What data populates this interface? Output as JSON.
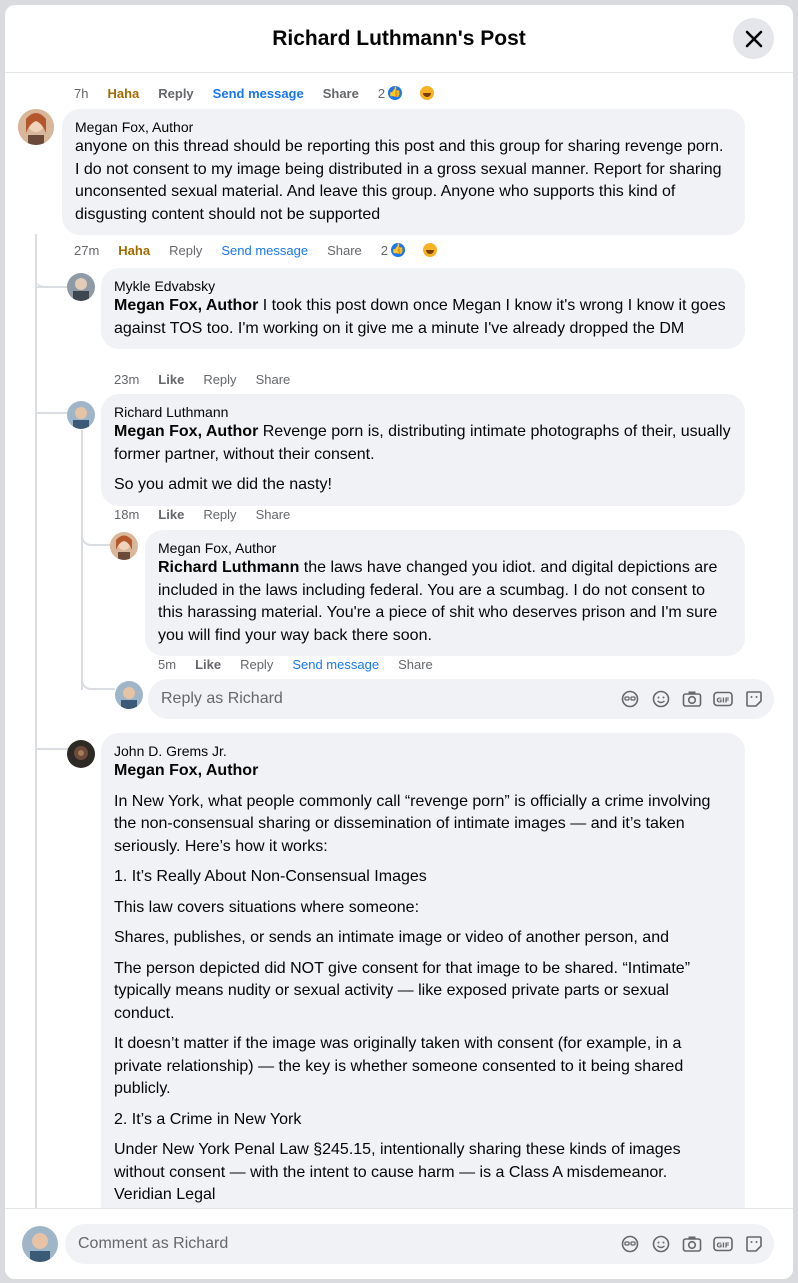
{
  "header": {
    "title": "Richard Luthmann's Post"
  },
  "top_actions": {
    "time": "7h",
    "reaction": "Haha",
    "reply": "Reply",
    "send": "Send message",
    "share": "Share",
    "count": "2"
  },
  "c1": {
    "name": "Megan Fox, Author",
    "text": "anyone on this thread should be reporting this post and this group for sharing revenge porn. I do not consent to my image being distributed in a gross sexual manner. Report for sharing unconsented sexual material. And leave this group. Anyone who supports this kind of disgusting content should not be supported",
    "time": "27m",
    "reaction": "Haha",
    "reply": "Reply",
    "send": "Send message",
    "share": "Share",
    "count": "2"
  },
  "c2": {
    "name": "Mykle Edvabsky",
    "tag": "Megan Fox, Author",
    "text": " I took this post down once Megan I know it's wrong I know it goes against TOS too. I'm working on it give me a minute I've already dropped the DM",
    "time": "23m",
    "like": "Like",
    "reply": "Reply",
    "share": "Share"
  },
  "c3": {
    "name": "Richard Luthmann",
    "tag": "Megan Fox, Author",
    "text": " Revenge porn is, distributing intimate photographs of their, usually former partner, without their consent.",
    "text2": "So you admit we did the nasty!",
    "time": "18m",
    "like": "Like",
    "reply": "Reply",
    "share": "Share"
  },
  "c4": {
    "name": "Megan Fox, Author",
    "tag": "Richard Luthmann",
    "text": " the laws have changed you idiot. and digital depictions are included in the laws including federal. You are a scumbag. I do not consent to this harassing material. You're a piece of shit who deserves prison and I'm sure you will find your way back there soon.",
    "time": "5m",
    "like": "Like",
    "reply": "Reply",
    "send": "Send message",
    "share": "Share"
  },
  "reply_box": {
    "placeholder": "Reply as Richard"
  },
  "c5": {
    "name": "John D. Grems Jr.",
    "tag": "Megan Fox, Author",
    "paras": [
      "In New York, what people commonly call “revenge porn” is officially a crime involving the non-consensual sharing or dissemination of intimate images — and it’s taken seriously. Here’s how it works:",
      "1. It’s Really About Non-Consensual Images",
      "This law covers situations where someone:",
      "Shares, publishes, or sends an intimate image or video of another person, and",
      "The person depicted did NOT give consent for that image to be shared. “Intimate” typically means nudity or sexual activity — like exposed private parts or sexual conduct.",
      "It doesn’t matter if the image was originally taken with consent (for example, in a private relationship) — the key is whether someone consented to it being shared publicly.",
      "2. It’s a Crime in New York",
      "Under New York Penal Law §245.15, intentionally sharing these kinds of images without consent — with the intent to cause harm — is a Class A misdemeanor.",
      "Veridian Legal"
    ]
  },
  "footer": {
    "placeholder": "Comment as Richard"
  },
  "icons": [
    "avatar-sticker-icon",
    "emoji-icon",
    "camera-icon",
    "gif-icon",
    "sticker-icon"
  ],
  "colors": {
    "link": "#1877f2",
    "haha": "#a36a00",
    "bubble": "#f0f2f5",
    "muted": "#65676b"
  }
}
